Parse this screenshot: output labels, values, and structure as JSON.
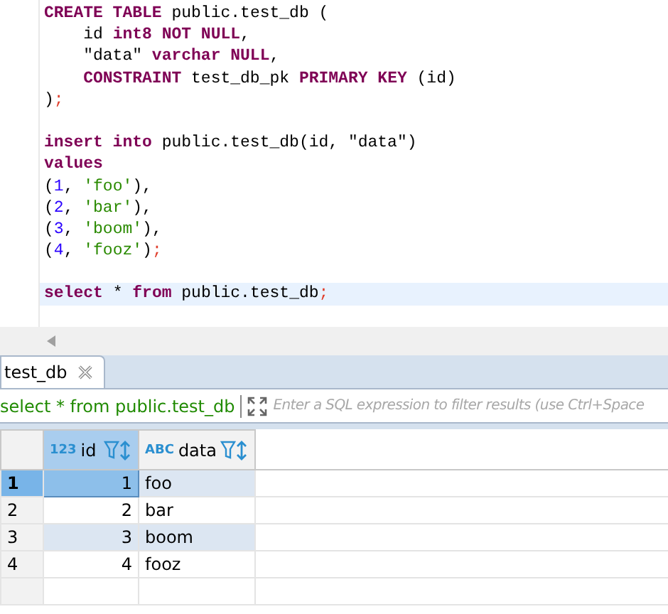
{
  "editor": {
    "lines": [
      {
        "current": false,
        "blank_after": false,
        "tokens": [
          {
            "kind": "keyword",
            "text": "CREATE TABLE"
          },
          {
            "kind": "plain",
            "text": " public.test_db ("
          }
        ]
      },
      {
        "current": false,
        "blank_after": false,
        "tokens": [
          {
            "kind": "plain",
            "text": "    id "
          },
          {
            "kind": "keyword",
            "text": "int8 NOT NULL"
          },
          {
            "kind": "plain",
            "text": ","
          }
        ]
      },
      {
        "current": false,
        "blank_after": false,
        "tokens": [
          {
            "kind": "plain",
            "text": "    \"data\" "
          },
          {
            "kind": "keyword",
            "text": "varchar NULL"
          },
          {
            "kind": "plain",
            "text": ","
          }
        ]
      },
      {
        "current": false,
        "blank_after": false,
        "tokens": [
          {
            "kind": "keyword",
            "text": "    CONSTRAINT"
          },
          {
            "kind": "plain",
            "text": " test_db_pk "
          },
          {
            "kind": "keyword",
            "text": "PRIMARY KEY"
          },
          {
            "kind": "plain",
            "text": " (id)"
          }
        ]
      },
      {
        "current": false,
        "blank_after": true,
        "tokens": [
          {
            "kind": "plain",
            "text": ")"
          },
          {
            "kind": "punct",
            "text": ";"
          }
        ]
      },
      {
        "current": false,
        "blank_after": false,
        "tokens": [
          {
            "kind": "keyword",
            "text": "insert into"
          },
          {
            "kind": "plain",
            "text": " public.test_db(id, \"data\")"
          }
        ]
      },
      {
        "current": false,
        "blank_after": false,
        "tokens": [
          {
            "kind": "keyword",
            "text": "values"
          }
        ]
      },
      {
        "current": false,
        "blank_after": false,
        "tokens": [
          {
            "kind": "plain",
            "text": "("
          },
          {
            "kind": "number",
            "text": "1"
          },
          {
            "kind": "plain",
            "text": ", "
          },
          {
            "kind": "string",
            "text": "'foo'"
          },
          {
            "kind": "plain",
            "text": "),"
          }
        ]
      },
      {
        "current": false,
        "blank_after": false,
        "tokens": [
          {
            "kind": "plain",
            "text": "("
          },
          {
            "kind": "number",
            "text": "2"
          },
          {
            "kind": "plain",
            "text": ", "
          },
          {
            "kind": "string",
            "text": "'bar'"
          },
          {
            "kind": "plain",
            "text": "),"
          }
        ]
      },
      {
        "current": false,
        "blank_after": false,
        "tokens": [
          {
            "kind": "plain",
            "text": "("
          },
          {
            "kind": "number",
            "text": "3"
          },
          {
            "kind": "plain",
            "text": ", "
          },
          {
            "kind": "string",
            "text": "'boom'"
          },
          {
            "kind": "plain",
            "text": "),"
          }
        ]
      },
      {
        "current": false,
        "blank_after": true,
        "tokens": [
          {
            "kind": "plain",
            "text": "("
          },
          {
            "kind": "number",
            "text": "4"
          },
          {
            "kind": "plain",
            "text": ", "
          },
          {
            "kind": "string",
            "text": "'fooz'"
          },
          {
            "kind": "plain",
            "text": ")"
          },
          {
            "kind": "punct",
            "text": ";"
          }
        ]
      },
      {
        "current": true,
        "blank_after": false,
        "tokens": [
          {
            "kind": "keyword",
            "text": "select"
          },
          {
            "kind": "plain",
            "text": " * "
          },
          {
            "kind": "keyword",
            "text": "from"
          },
          {
            "kind": "plain",
            "text": " public.test_db"
          },
          {
            "kind": "punct",
            "text": ";"
          }
        ]
      }
    ]
  },
  "results": {
    "tab": {
      "label": "test_db",
      "selected": true
    },
    "query": "select * from public.test_db",
    "filter": {
      "placeholder": "Enter a SQL expression to filter results (use Ctrl+Space"
    },
    "columns": [
      {
        "kind": "number",
        "type_label": "123",
        "label": "id"
      },
      {
        "kind": "text",
        "type_label": "ABC",
        "label": "data"
      }
    ],
    "rows": [
      {
        "number": "1",
        "selected": true,
        "cells": [
          "1",
          "foo"
        ]
      },
      {
        "number": "2",
        "selected": false,
        "cells": [
          "2",
          "bar"
        ]
      },
      {
        "number": "3",
        "selected": false,
        "cells": [
          "3",
          "boom"
        ]
      },
      {
        "number": "4",
        "selected": false,
        "cells": [
          "4",
          "fooz"
        ]
      }
    ]
  }
}
